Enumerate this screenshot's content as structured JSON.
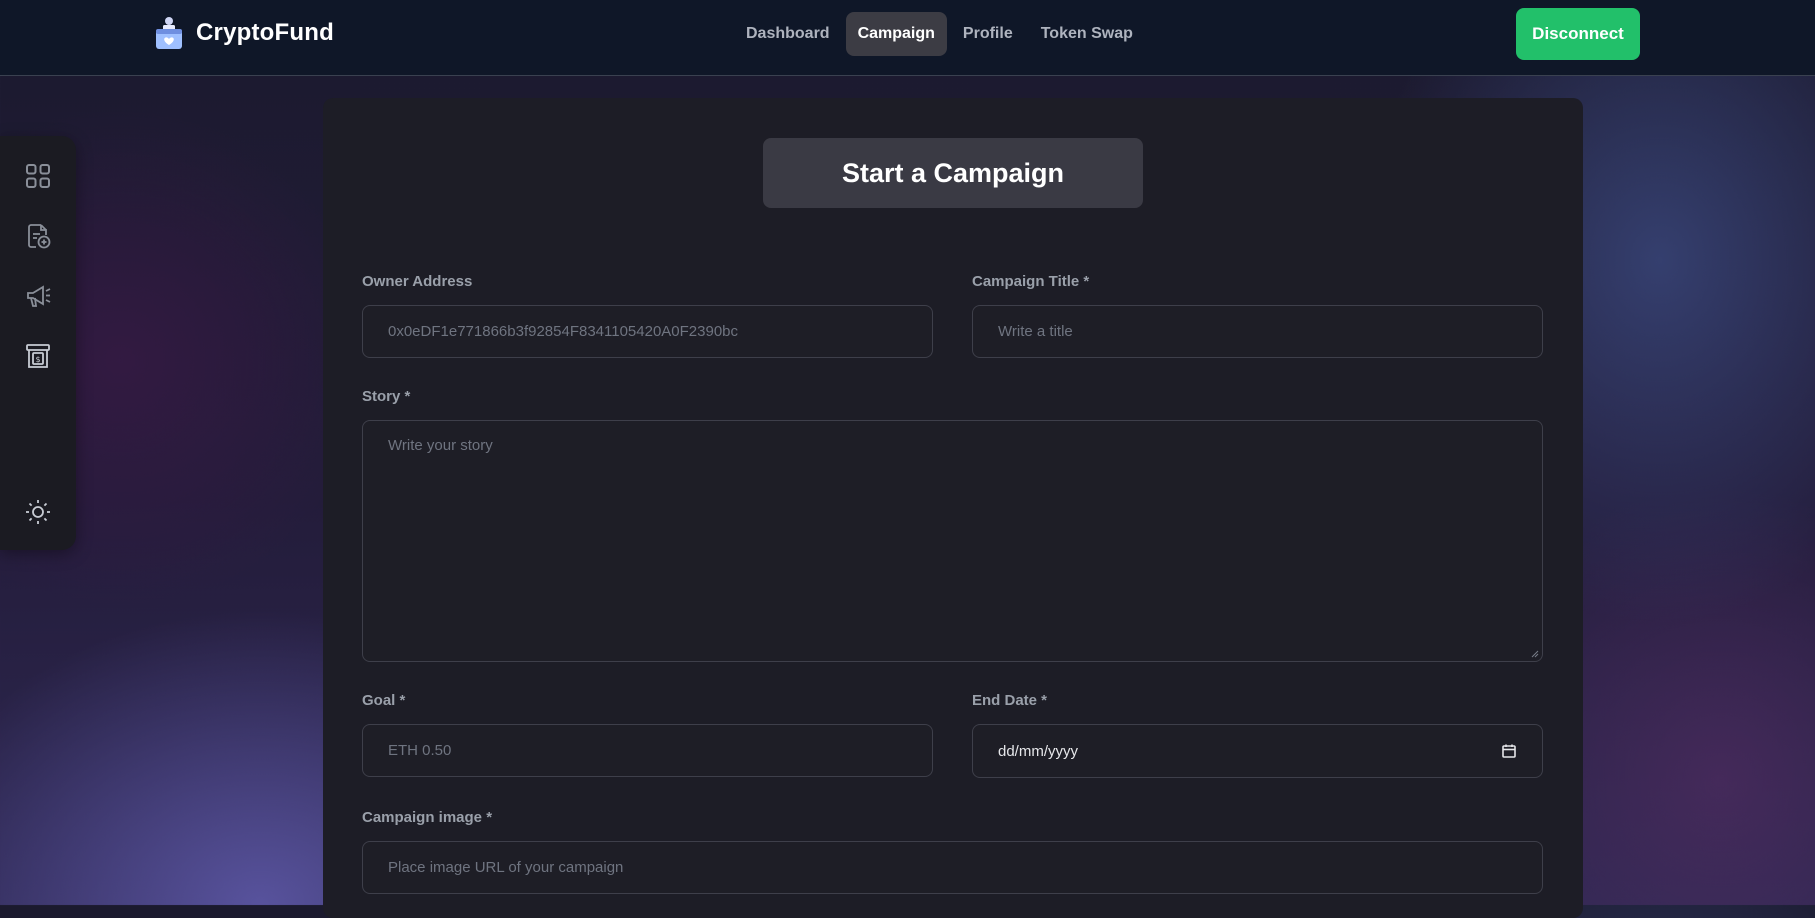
{
  "app": {
    "name": "CryptoFund"
  },
  "nav": {
    "tabs": [
      {
        "label": "Dashboard",
        "active": false
      },
      {
        "label": "Campaign",
        "active": true
      },
      {
        "label": "Profile",
        "active": false
      },
      {
        "label": "Token Swap",
        "active": false
      }
    ],
    "disconnect_label": "Disconnect"
  },
  "sidebar": {
    "icons": [
      "grid-icon",
      "file-add-icon",
      "megaphone-icon",
      "cash-register-icon"
    ],
    "theme_toggle_icon": "sun-icon"
  },
  "form": {
    "title": "Start a Campaign",
    "owner_address": {
      "label": "Owner Address",
      "value": "0x0eDF1e771866b3f92854F8341105420A0F2390bc"
    },
    "campaign_title": {
      "label": "Campaign Title *",
      "placeholder": "Write a title"
    },
    "story": {
      "label": "Story *",
      "placeholder": "Write your story"
    },
    "goal": {
      "label": "Goal *",
      "placeholder": "ETH 0.50"
    },
    "end_date": {
      "label": "End Date *",
      "placeholder": "dd/mm/yyyy"
    },
    "campaign_image": {
      "label": "Campaign image *",
      "placeholder": "Place image URL of your campaign"
    }
  },
  "colors": {
    "accent_green": "#22c06a",
    "active_tab": "#3c3c44",
    "card_bg": "#1d1d26"
  }
}
